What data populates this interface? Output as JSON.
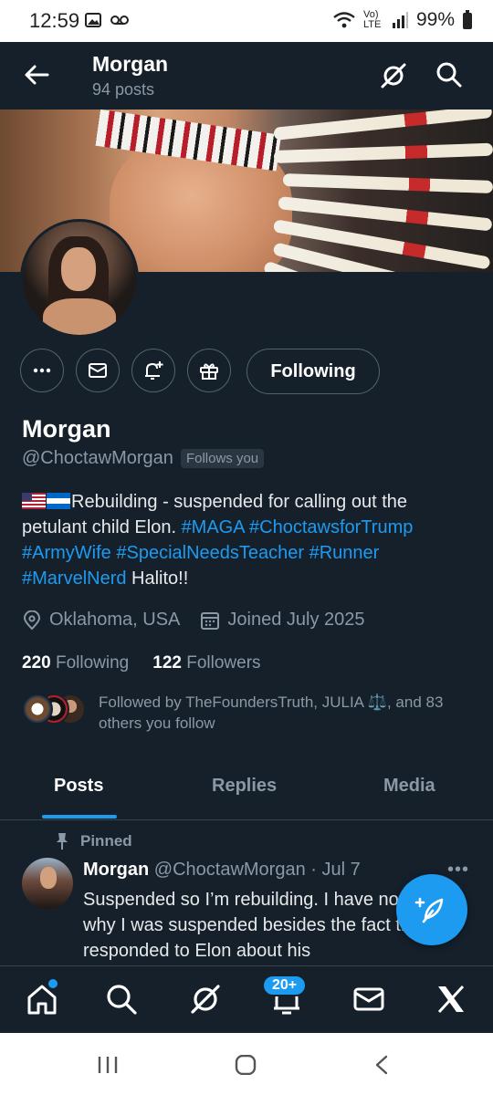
{
  "status_bar": {
    "time": "12:59",
    "battery": "99%",
    "network": "Vo) LTE"
  },
  "header": {
    "title": "Morgan",
    "subtitle": "94 posts"
  },
  "profile": {
    "name": "Morgan",
    "handle": "@ChoctawMorgan",
    "follows_you": "Follows you",
    "following_button": "Following",
    "bio": {
      "text_1": "Rebuilding - suspended for calling out the petulant child Elon. ",
      "tags_line1": [
        "#MAGA",
        "#ChoctawsforTrump"
      ],
      "tags_line2": [
        "#ArmyWife",
        "#SpecialNeedsTeacher",
        "#Runner"
      ],
      "tag_line3": "#MarvelNerd",
      "suffix": " Halito!!"
    },
    "location": "Oklahoma, USA",
    "joined": "Joined July 2025",
    "following_count": "220",
    "following_label": "Following",
    "followers_count": "122",
    "followers_label": "Followers",
    "followed_by": "Followed by TheFoundersTruth, JULIA ⚖️, and 83 others you follow"
  },
  "tabs": [
    "Posts",
    "Replies",
    "Media"
  ],
  "pinned_post": {
    "pinned_label": "Pinned",
    "author": "Morgan",
    "handle": "@ChoctawMorgan",
    "date": "· Jul 7",
    "text": "Suspended so I’m rebuilding. I have no reason why I was suspended besides the fact that I responded to Elon about his"
  },
  "bottom_nav": {
    "notifications_badge": "20+"
  },
  "colors": {
    "background": "#15202b",
    "accent": "#1d9bf0",
    "muted_text": "#8b98a5",
    "border": "#536471"
  },
  "icons": [
    "back-arrow-icon",
    "grok-icon",
    "search-icon",
    "more-icon",
    "mail-icon",
    "notify-bell-plus-icon",
    "gift-icon",
    "location-pin-icon",
    "calendar-icon",
    "pin-icon",
    "compose-feather-icon",
    "home-icon",
    "explore-icon",
    "bell-icon",
    "x-logo-icon"
  ]
}
